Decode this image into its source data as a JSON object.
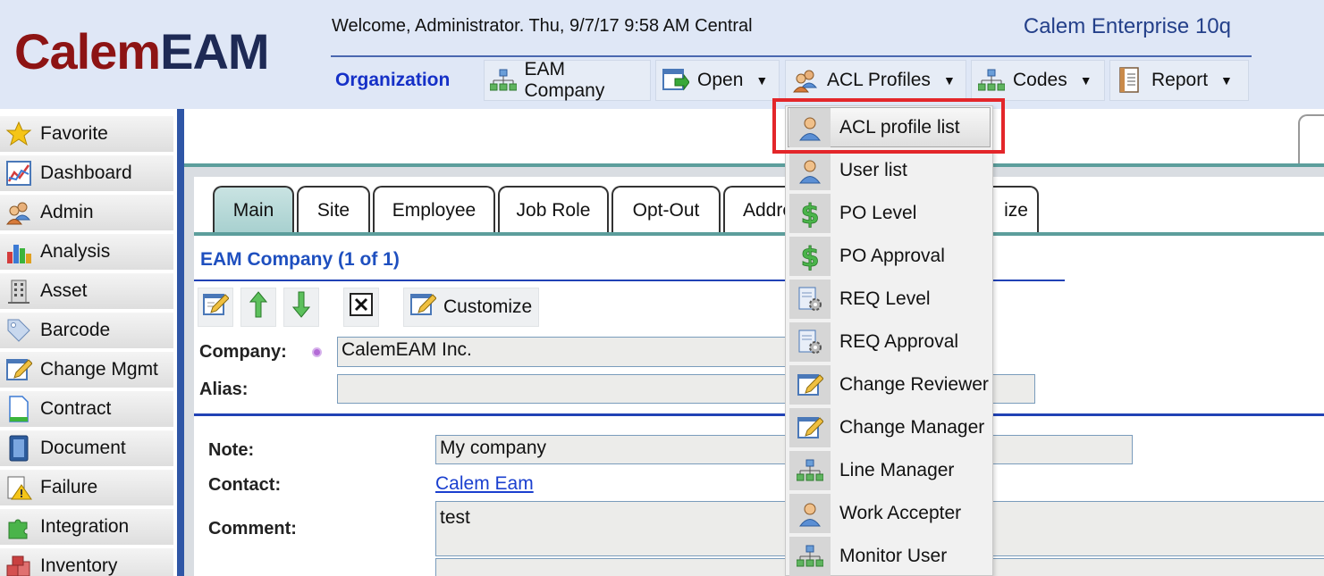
{
  "header": {
    "logo_part1": "Calem",
    "logo_part2": "EAM",
    "welcome": "Welcome, Administrator. Thu, 9/7/17 9:58 AM Central",
    "product": "Calem Enterprise 10q",
    "section_label": "Organization"
  },
  "toolbar": [
    {
      "label": "EAM Company",
      "icon": "org-chart-icon",
      "has_menu": false
    },
    {
      "label": "Open",
      "icon": "open-window-icon",
      "has_menu": true
    },
    {
      "label": "ACL Profiles",
      "icon": "users-icon",
      "has_menu": true
    },
    {
      "label": "Codes",
      "icon": "org-chart-icon",
      "has_menu": true
    },
    {
      "label": "Report",
      "icon": "report-icon",
      "has_menu": true
    }
  ],
  "sidebar": {
    "items": [
      {
        "label": "Favorite",
        "icon": "star-icon"
      },
      {
        "label": "Dashboard",
        "icon": "dashboard-chart-icon"
      },
      {
        "label": "Admin",
        "icon": "users-icon"
      },
      {
        "label": "Analysis",
        "icon": "bar-chart-icon"
      },
      {
        "label": "Asset",
        "icon": "building-icon"
      },
      {
        "label": "Barcode",
        "icon": "tag-icon"
      },
      {
        "label": "Change Mgmt",
        "icon": "pencil-form-icon"
      },
      {
        "label": "Contract",
        "icon": "document-icon"
      },
      {
        "label": "Document",
        "icon": "binder-icon"
      },
      {
        "label": "Failure",
        "icon": "warning-icon"
      },
      {
        "label": "Integration",
        "icon": "puzzle-icon"
      },
      {
        "label": "Inventory",
        "icon": "boxes-icon"
      }
    ]
  },
  "tabs": [
    {
      "label": "Main",
      "active": true
    },
    {
      "label": "Site",
      "active": false
    },
    {
      "label": "Employee",
      "active": false
    },
    {
      "label": "Job Role",
      "active": false
    },
    {
      "label": "Opt-Out",
      "active": false
    },
    {
      "label": "Addre",
      "active": false
    },
    {
      "label": "ize",
      "active": false
    }
  ],
  "section": {
    "title": "EAM Company (1 of 1)",
    "customize_label": "Customize"
  },
  "form": {
    "company_label": "Company:",
    "company_value": "CalemEAM Inc.",
    "alias_label": "Alias:",
    "alias_value": "",
    "note_label": "Note:",
    "note_value": "My company",
    "contact_label": "Contact:",
    "contact_value": "Calem Eam",
    "comment_label": "Comment:",
    "comment_value": "test"
  },
  "dropdown": {
    "items": [
      {
        "label": "ACL profile list",
        "icon": "user-icon",
        "selected": true
      },
      {
        "label": "User list",
        "icon": "user-icon"
      },
      {
        "label": "PO Level",
        "icon": "dollar-icon"
      },
      {
        "label": "PO Approval",
        "icon": "dollar-icon"
      },
      {
        "label": "REQ Level",
        "icon": "req-gear-icon"
      },
      {
        "label": "REQ Approval",
        "icon": "req-gear-icon"
      },
      {
        "label": "Change Reviewer",
        "icon": "pencil-form-icon"
      },
      {
        "label": "Change Manager",
        "icon": "pencil-form-icon"
      },
      {
        "label": "Line Manager",
        "icon": "org-chart-icon"
      },
      {
        "label": "Work Accepter",
        "icon": "user-icon"
      },
      {
        "label": "Monitor User",
        "icon": "org-chart-icon"
      }
    ]
  },
  "colors": {
    "header_bg": "#dfe7f6",
    "logo_red": "#8d1414",
    "logo_navy": "#1e2a55",
    "accent_blue": "#2142b5",
    "teal": "#5c9e9c",
    "highlight_red": "#e3262a"
  }
}
